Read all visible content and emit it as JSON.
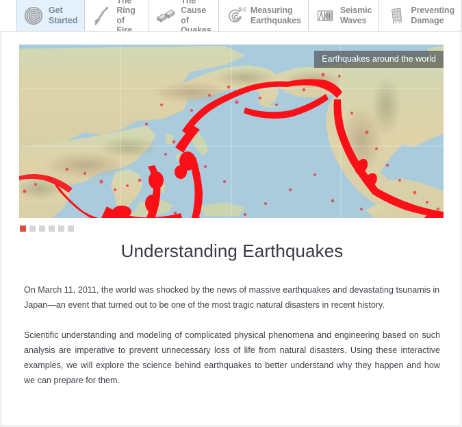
{
  "tabs": [
    {
      "id": "get-started",
      "label": "Get\nStarted",
      "icon": "concentric-rings-icon",
      "active": true
    },
    {
      "id": "the-ring-of-fire",
      "label": "The Ring\nof Fire",
      "icon": "japan-map-icon",
      "active": false
    },
    {
      "id": "the-cause-of-quakes",
      "label": "The Cause\nof Quakes",
      "icon": "fault-block-icon",
      "active": false
    },
    {
      "id": "measuring-earthquakes",
      "label": "Measuring\nEarthquakes",
      "icon": "magnitude-spiral-icon",
      "active": false,
      "icon_text": "9.0"
    },
    {
      "id": "seismic-waves",
      "label": "Seismic\nWaves",
      "icon": "seismogram-icon",
      "active": false
    },
    {
      "id": "preventing-damage",
      "label": "Preventing\nDamage",
      "icon": "building-frame-icon",
      "active": false
    }
  ],
  "slider": {
    "caption": "Earthquakes around the world",
    "pager": {
      "count": 6,
      "active_index": 0
    },
    "colors": {
      "ocean": "#a9cbdc",
      "land": "#d9ceac",
      "quake_marker": "#fb1018",
      "active_dot": "#d94c3d",
      "inactive_dot": "#d5d5d5"
    }
  },
  "article": {
    "title": "Understanding Earthquakes",
    "paragraphs": [
      "On March 11, 2011, the world was shocked by the news of massive earthquakes and devastating tsunamis in Japan—an event that turned out to be one of the most tragic natural disasters in recent history.",
      "Scientific understanding and modeling of complicated physical phenomena and engineering based on such analysis are imperative to prevent unnecessary loss of life from natural disasters. Using these interactive examples, we will explore the science behind earthquakes to better understand why they happen and how we can prepare for them."
    ]
  }
}
